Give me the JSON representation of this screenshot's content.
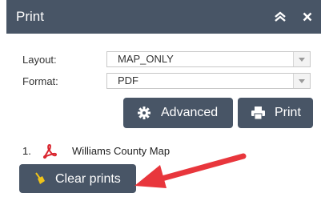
{
  "header": {
    "title": "Print",
    "collapse_icon": "double-chevron-up-icon",
    "close_icon": "close-icon",
    "background": "#485566"
  },
  "form": {
    "layout": {
      "label": "Layout:",
      "value": "MAP_ONLY"
    },
    "format": {
      "label": "Format:",
      "value": "PDF"
    }
  },
  "buttons": {
    "advanced": {
      "label": "Advanced",
      "icon": "gear-icon"
    },
    "print": {
      "label": "Print",
      "icon": "printer-icon"
    },
    "clear": {
      "label": "Clear prints",
      "icon": "broom-icon"
    }
  },
  "prints": [
    {
      "index": "1.",
      "icon": "pdf-icon",
      "title": "Williams County Map"
    }
  ],
  "annotation": {
    "type": "arrow",
    "color": "#e8363c",
    "points_to": "clear-prints-button"
  }
}
